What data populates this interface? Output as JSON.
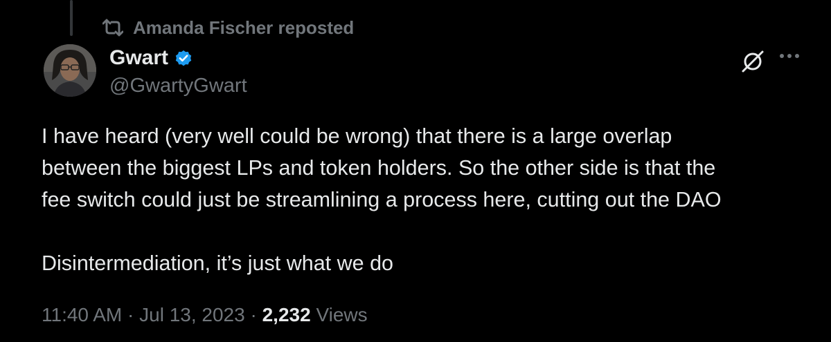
{
  "repost": {
    "text": "Amanda Fischer reposted"
  },
  "author": {
    "name": "Gwart",
    "handle": "@GwartyGwart",
    "verified": true
  },
  "tweet": {
    "lines": [
      "I have heard (very well could be wrong) that there is a large overlap",
      "between the biggest LPs and token holders. So the other side is that the",
      "fee switch could just be streamlining a process here, cutting out the DAO"
    ],
    "second_paragraph": "Disintermediation, it’s just what we do"
  },
  "meta": {
    "time": "11:40 AM",
    "separator": "·",
    "date": "Jul 13, 2023",
    "views_count": "2,232",
    "views_label": "Views"
  },
  "icons": {
    "repost": "repost-icon",
    "verified": "verified-badge-icon",
    "grok": "grok-icon",
    "more": "more-icon"
  },
  "colors": {
    "background": "#000000",
    "text_primary": "#e7e9ea",
    "text_secondary": "#71767b",
    "verified_blue": "#1d9bf0"
  }
}
